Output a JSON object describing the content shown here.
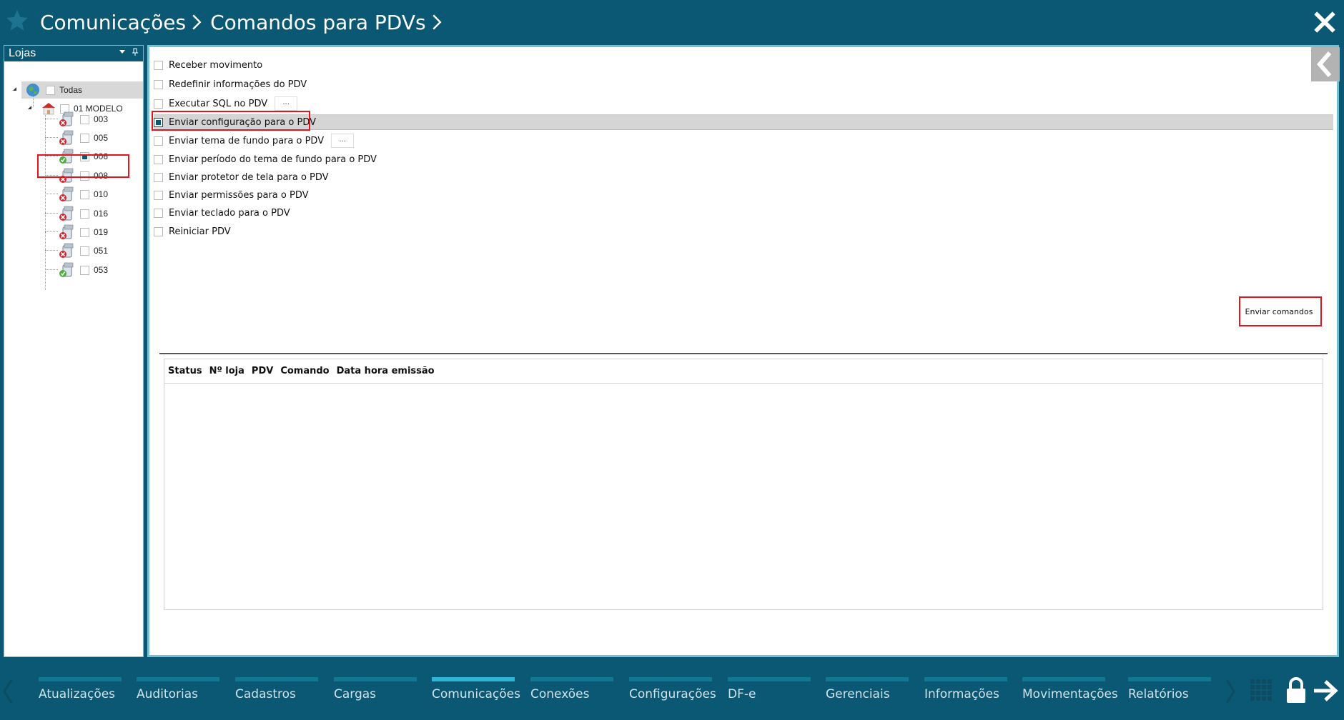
{
  "breadcrumb": {
    "items": [
      "Comunicações",
      "Comandos para PDVs"
    ]
  },
  "stores_panel": {
    "title": "Lojas",
    "tree": {
      "root": {
        "label": "Todas",
        "checked": false
      },
      "group": {
        "label": "01 MODELO",
        "checked": false
      },
      "stores": [
        {
          "label": "003",
          "status": "offline",
          "checked": false
        },
        {
          "label": "005",
          "status": "offline",
          "checked": false
        },
        {
          "label": "006",
          "status": "online",
          "checked": true
        },
        {
          "label": "008",
          "status": "offline",
          "checked": false
        },
        {
          "label": "010",
          "status": "offline",
          "checked": false
        },
        {
          "label": "016",
          "status": "offline",
          "checked": false
        },
        {
          "label": "019",
          "status": "offline",
          "checked": false
        },
        {
          "label": "051",
          "status": "offline",
          "checked": false
        },
        {
          "label": "053",
          "status": "online",
          "checked": false
        }
      ]
    }
  },
  "commands": [
    {
      "label": "Receber movimento",
      "checked": false
    },
    {
      "label": "Redefinir informações do PDV",
      "checked": false
    },
    {
      "label": "Executar SQL no PDV",
      "checked": false,
      "ellipsis": "..."
    },
    {
      "label": "Enviar configuração para o PDV",
      "checked": true,
      "selected": true
    },
    {
      "label": "Enviar tema de fundo para o PDV",
      "checked": false,
      "ellipsis": "..."
    },
    {
      "label": "Enviar período do tema de fundo para o PDV",
      "checked": false
    },
    {
      "label": "Enviar protetor de tela para o PDV",
      "checked": false
    },
    {
      "label": "Enviar permissões para o PDV",
      "checked": false
    },
    {
      "label": "Enviar teclado para o PDV",
      "checked": false
    },
    {
      "label": "Reiniciar PDV",
      "checked": false
    }
  ],
  "send_button": {
    "label": "Enviar comandos"
  },
  "grid": {
    "columns": [
      "Status",
      "Nº loja",
      "PDV",
      "Comando",
      "Data hora emissão"
    ]
  },
  "bottom_nav": {
    "items": [
      {
        "label": "Atualizações",
        "active": false
      },
      {
        "label": "Auditorias",
        "active": false
      },
      {
        "label": "Cadastros",
        "active": false
      },
      {
        "label": "Cargas",
        "active": false
      },
      {
        "label": "Comunicações",
        "active": true
      },
      {
        "label": "Conexões",
        "active": false
      },
      {
        "label": "Configurações",
        "active": false
      },
      {
        "label": "DF-e",
        "active": false
      },
      {
        "label": "Gerenciais",
        "active": false
      },
      {
        "label": "Informações",
        "active": false
      },
      {
        "label": "Movimentações",
        "active": false
      },
      {
        "label": "Relatórios",
        "active": false
      }
    ]
  },
  "colors": {
    "brand": "#0b5874",
    "accent": "#2fb3d6",
    "highlight": "#e3141b"
  }
}
